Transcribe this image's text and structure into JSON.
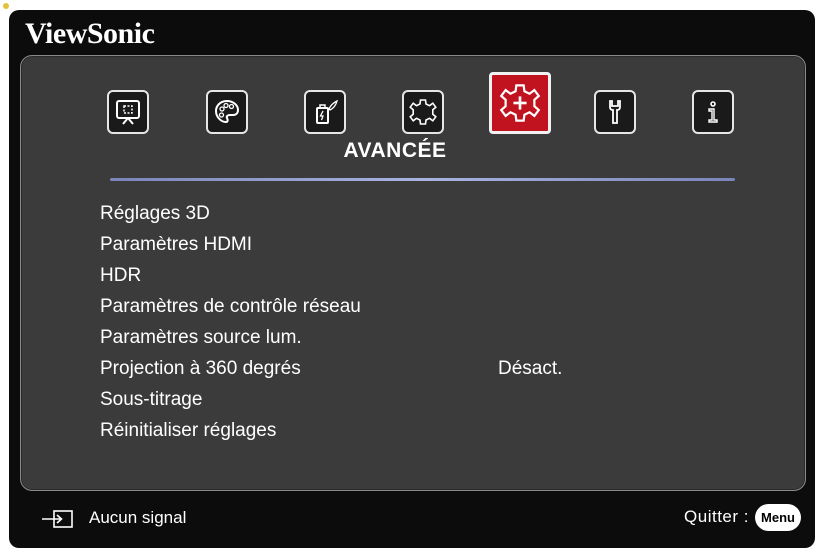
{
  "brand": "ViewSonic",
  "tabs": [
    {
      "icon": "display-icon",
      "active": false
    },
    {
      "icon": "palette-icon",
      "active": false
    },
    {
      "icon": "power-eco-icon",
      "active": false
    },
    {
      "icon": "basic-gear-icon",
      "active": false
    },
    {
      "icon": "advanced-gear-icon",
      "active": true
    },
    {
      "icon": "wrench-icon",
      "active": false
    },
    {
      "icon": "info-icon",
      "active": false
    }
  ],
  "menu": {
    "title": "AVANCÉE",
    "items": [
      {
        "label": "Réglages 3D",
        "value": ""
      },
      {
        "label": "Paramètres HDMI",
        "value": ""
      },
      {
        "label": "HDR",
        "value": ""
      },
      {
        "label": "Paramètres de contrôle réseau",
        "value": ""
      },
      {
        "label": "Paramètres source lum.",
        "value": ""
      },
      {
        "label": "Projection à 360 degrés",
        "value": "Désact."
      },
      {
        "label": "Sous-titrage",
        "value": ""
      },
      {
        "label": "Réinitialiser réglages",
        "value": ""
      }
    ]
  },
  "footer": {
    "signal_icon": "input-source-icon",
    "signal_text": "Aucun signal",
    "exit_label": "Quitter :",
    "menu_key": "Menu"
  },
  "colors": {
    "active_tab": "#c1121f",
    "panel": "#3b3b3b",
    "frame": "#0c0c0c",
    "divider": "#aab3e0"
  }
}
